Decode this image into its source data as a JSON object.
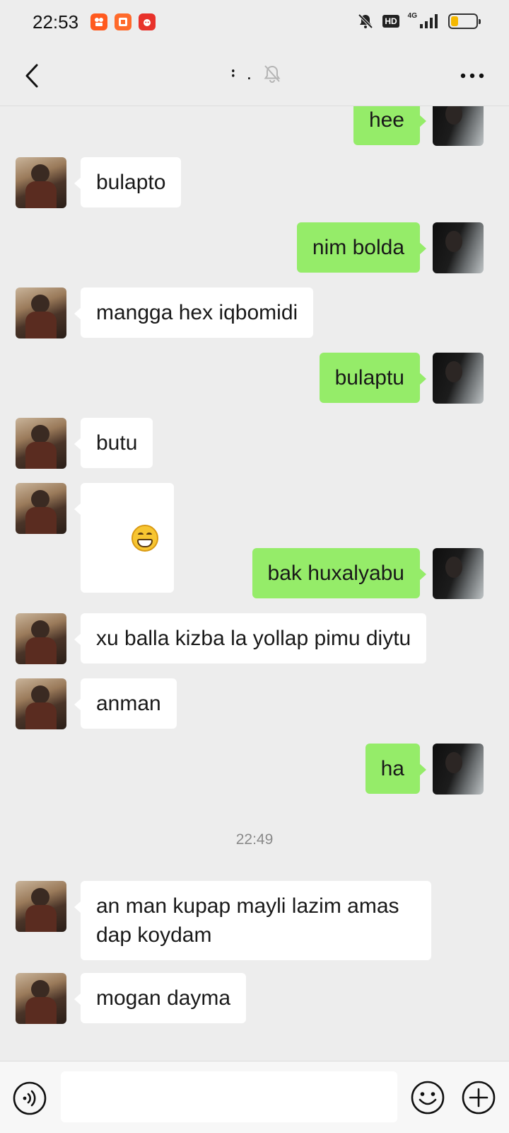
{
  "status_bar": {
    "time": "22:53",
    "hd_label": "HD",
    "network_label": "4G",
    "battery_level": 0.3,
    "app_badges": [
      {
        "icon": "kuaishou-app-icon",
        "color": "#ff5a1f"
      },
      {
        "icon": "video-app-icon",
        "color": "#ff6a2b"
      },
      {
        "icon": "shopping-app-icon",
        "color": "#e8322b"
      }
    ]
  },
  "header": {
    "title": "᛬ .",
    "muted": true
  },
  "colors": {
    "background": "#ededed",
    "self_bubble": "#95ec69",
    "other_bubble": "#ffffff"
  },
  "messages": [
    {
      "sender": "self",
      "text": "hee"
    },
    {
      "sender": "other",
      "text": "bulapto"
    },
    {
      "sender": "self",
      "text": "nim bolda"
    },
    {
      "sender": "other",
      "text": "mangga hex iqbomidi"
    },
    {
      "sender": "self",
      "text": "bulaptu"
    },
    {
      "sender": "other",
      "text": "butu"
    },
    {
      "sender": "other",
      "emoji": "grin-emoji"
    },
    {
      "sender": "self",
      "text": "bak huxalyabu"
    },
    {
      "sender": "other",
      "text": "xu balla kizba la yollap pimu diytu"
    },
    {
      "sender": "other",
      "text": "anman"
    },
    {
      "sender": "self",
      "text": "ha"
    },
    {
      "timestamp": "22:49"
    },
    {
      "sender": "other",
      "text": "an man kupap mayli lazim amas\ndap koydam"
    },
    {
      "sender": "other",
      "text": "mogan dayma"
    }
  ],
  "input": {
    "value": "",
    "placeholder": ""
  }
}
